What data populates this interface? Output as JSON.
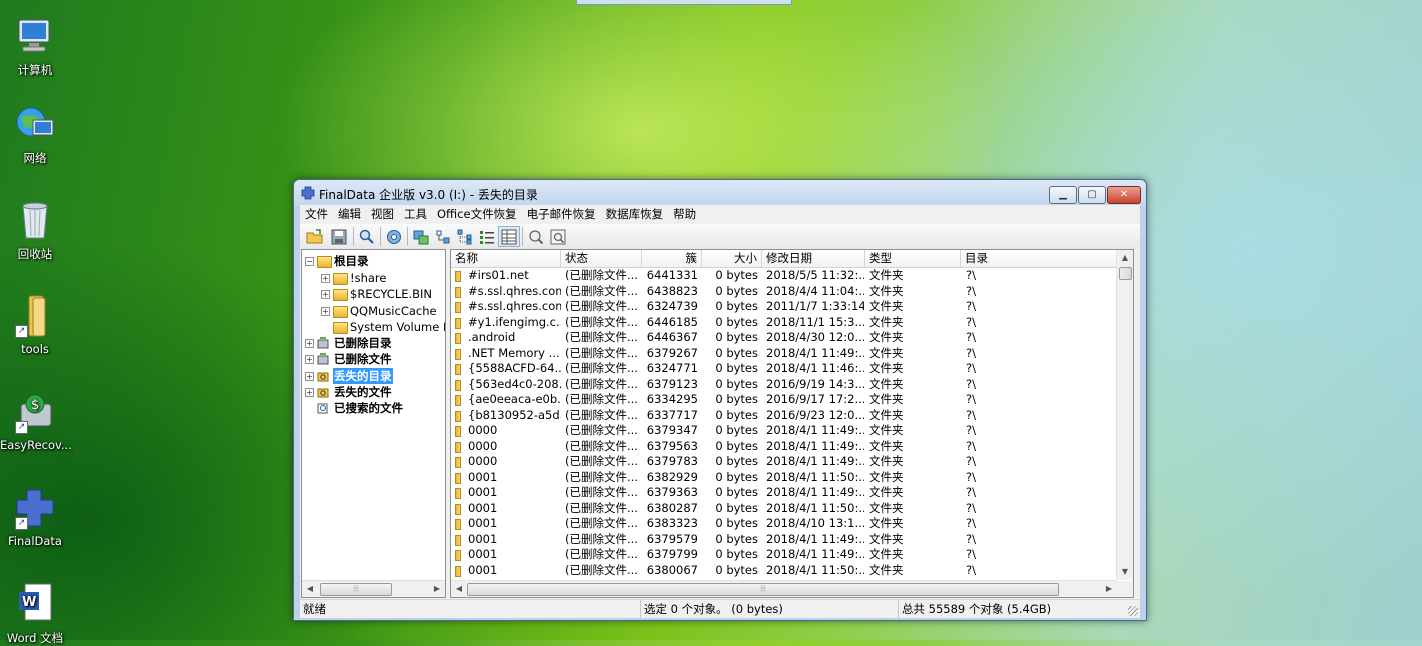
{
  "desktop": {
    "icons": [
      {
        "label": "计算机",
        "icon": "computer-icon"
      },
      {
        "label": "网络",
        "icon": "network-icon"
      },
      {
        "label": "回收站",
        "icon": "recycle-bin-icon"
      },
      {
        "label": "tools",
        "icon": "folder-icon"
      },
      {
        "label": "EasyRecov...",
        "icon": "easyrecovery-icon"
      },
      {
        "label": "FinalData",
        "icon": "finaldata-icon"
      },
      {
        "label": "Word 文档",
        "icon": "word-document-icon"
      }
    ]
  },
  "window": {
    "title": "FinalData 企业版 v3.0 (I:) - 丢失的目录",
    "controls": {
      "minimize": "▁",
      "maximize": "▢",
      "close": "✕"
    }
  },
  "menu": [
    "文件",
    "编辑",
    "视图",
    "工具",
    "Office文件恢复",
    "电子邮件恢复",
    "数据库恢复",
    "帮助"
  ],
  "toolbar": [
    "open-icon",
    "save-icon",
    "search-icon",
    "settings-icon",
    "recover-icon",
    "tree-small-icon",
    "tree-expand-icon",
    "list-view-icon",
    "details-view-icon",
    "find-icon",
    "preview-icon"
  ],
  "tree": {
    "root": "根目录",
    "root_children": [
      "!share",
      "$RECYCLE.BIN",
      "QQMusicCache",
      "System Volume I"
    ],
    "sections": [
      {
        "label": "已删除目录",
        "selected": false
      },
      {
        "label": "已删除文件",
        "selected": false
      },
      {
        "label": "丢失的目录",
        "selected": true
      },
      {
        "label": "丢失的文件",
        "selected": false
      },
      {
        "label": "已搜索的文件",
        "selected": false
      }
    ]
  },
  "list": {
    "columns": [
      "名称",
      "状态",
      "簇",
      "大小",
      "修改日期",
      "类型",
      "目录"
    ],
    "rows": [
      [
        "#irs01.net",
        "(已删除文件...",
        "6441331",
        "0 bytes",
        "2018/5/5 11:32:...",
        "文件夹",
        "?\\"
      ],
      [
        "#s.ssl.qhres.com",
        "(已删除文件...",
        "6438823",
        "0 bytes",
        "2018/4/4 11:04:...",
        "文件夹",
        "?\\"
      ],
      [
        "#s.ssl.qhres.com",
        "(已删除文件...",
        "6324739",
        "0 bytes",
        "2011/1/7 1:33:14",
        "文件夹",
        "?\\"
      ],
      [
        "#y1.ifengimg.c...",
        "(已删除文件...",
        "6446185",
        "0 bytes",
        "2018/11/1 15:3...",
        "文件夹",
        "?\\"
      ],
      [
        ".android",
        "(已删除文件...",
        "6446367",
        "0 bytes",
        "2018/4/30 12:0...",
        "文件夹",
        "?\\"
      ],
      [
        ".NET Memory ...",
        "(已删除文件...",
        "6379267",
        "0 bytes",
        "2018/4/1 11:49:...",
        "文件夹",
        "?\\"
      ],
      [
        "{5588ACFD-64...",
        "(已删除文件...",
        "6324771",
        "0 bytes",
        "2018/4/1 11:46:...",
        "文件夹",
        "?\\"
      ],
      [
        "{563ed4c0-208...",
        "(已删除文件...",
        "6379123",
        "0 bytes",
        "2016/9/19 14:3...",
        "文件夹",
        "?\\"
      ],
      [
        "{ae0eeaca-e0b...",
        "(已删除文件...",
        "6334295",
        "0 bytes",
        "2016/9/17 17:2...",
        "文件夹",
        "?\\"
      ],
      [
        "{b8130952-a5d...",
        "(已删除文件...",
        "6337717",
        "0 bytes",
        "2016/9/23 12:0...",
        "文件夹",
        "?\\"
      ],
      [
        "0000",
        "(已删除文件...",
        "6379347",
        "0 bytes",
        "2018/4/1 11:49:...",
        "文件夹",
        "?\\"
      ],
      [
        "0000",
        "(已删除文件...",
        "6379563",
        "0 bytes",
        "2018/4/1 11:49:...",
        "文件夹",
        "?\\"
      ],
      [
        "0000",
        "(已删除文件...",
        "6379783",
        "0 bytes",
        "2018/4/1 11:49:...",
        "文件夹",
        "?\\"
      ],
      [
        "0001",
        "(已删除文件...",
        "6382929",
        "0 bytes",
        "2018/4/1 11:50:...",
        "文件夹",
        "?\\"
      ],
      [
        "0001",
        "(已删除文件...",
        "6379363",
        "0 bytes",
        "2018/4/1 11:49:...",
        "文件夹",
        "?\\"
      ],
      [
        "0001",
        "(已删除文件...",
        "6380287",
        "0 bytes",
        "2018/4/1 11:50:...",
        "文件夹",
        "?\\"
      ],
      [
        "0001",
        "(已删除文件...",
        "6383323",
        "0 bytes",
        "2018/4/10 13:1...",
        "文件夹",
        "?\\"
      ],
      [
        "0001",
        "(已删除文件...",
        "6379579",
        "0 bytes",
        "2018/4/1 11:49:...",
        "文件夹",
        "?\\"
      ],
      [
        "0001",
        "(已删除文件...",
        "6379799",
        "0 bytes",
        "2018/4/1 11:49:...",
        "文件夹",
        "?\\"
      ],
      [
        "0001",
        "(已删除文件...",
        "6380067",
        "0 bytes",
        "2018/4/1 11:50:...",
        "文件夹",
        "?\\"
      ]
    ]
  },
  "status": {
    "ready": "就绪",
    "selected": "选定 0 个对象。 (0 bytes)",
    "total": "总共 55589 个对象 (5.4GB)"
  }
}
